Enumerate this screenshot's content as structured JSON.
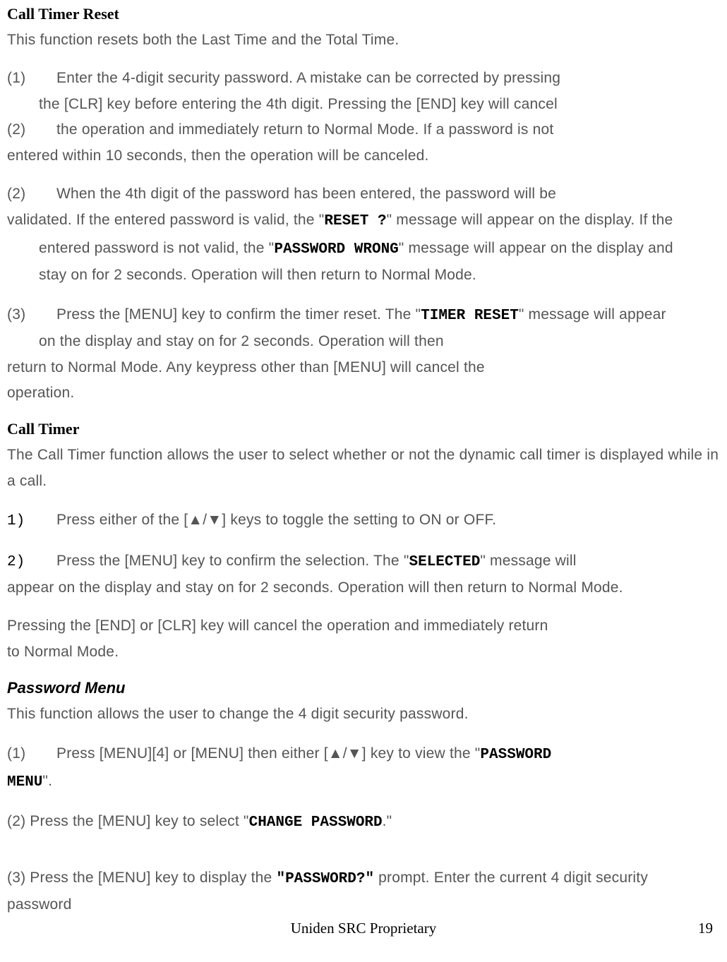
{
  "h1": "Call Timer Reset",
  "p1": "This function resets both the Last Time and the Total Time.",
  "s1n": "(1)",
  "s1a": "Enter the 4-digit security password.  A mistake can be corrected by pressing",
  "s1b": "the [CLR] key before entering the 4th digit. Pressing the [END] key will cancel",
  "s2n": "(2)",
  "s1c": "the operation and immediately return to Normal Mode. If a password is not",
  "s1d": "entered within 10 seconds, then the operation will be canceled.",
  "s2a_n": "(2)",
  "s2a": "When the 4th digit of the password has been entered, the password will be",
  "s2b_pre": "validated.  If  the  entered  password  is  valid,  the  \"",
  "s2b_reset": "RESET ?",
  "s2b_post": "\"  message  will  appear  on  the  display.  If  the",
  "s2c_pre": "entered  password  is  not  valid,  the  \"",
  "s2c_pw": "PASSWORD WRONG",
  "s2c_post": "\"  message  will  appear  on  the  display  and",
  "s2d": "stay on for 2 seconds.  Operation will then return to Normal Mode.",
  "s3n": "(3)",
  "s3a_pre": "Press  the  [MENU]  key  to  confirm  the  timer  reset.   The \"",
  "s3a_tr": "TIMER RESET",
  "s3a_post": "\"  message  will  appear",
  "s3b": "on the display and stay on for 2 seconds. Operation will then",
  "s3c": "return to Normal Mode. Any keypress other than [MENU] will cancel the",
  "s3d": "operation.",
  "h2": "Call Timer",
  "p2a": "The Call Timer function allows the user to select whether or not the dynamic call timer is displayed while in",
  "p2b": "a call.",
  "ct1n": "1)",
  "ct1a": "Press either of  the ",
  "arrows": "[▲/▼]",
  "ct1b": " keys to toggle the setting to ON or OFF.",
  "ct2n": "2)",
  "ct2a": "Press the [MENU] key to confirm the selection. The \"",
  "ct2_sel": "SELECTED",
  "ct2b": "\" message will",
  "ct2c": "appear on the display and stay on for 2 seconds. Operation will then return to Normal Mode.",
  "ct3a": "Pressing the [END] or [CLR] key will cancel the operation and immediately return",
  "ct3b": "to Normal Mode.",
  "h3": "Password Menu",
  "p3": "This function allows the user to change the 4 digit security password.",
  "pm1n": "(1)",
  "pm1a": "Press [MENU][4] or [MENU] then  either ",
  "pm1b": " key to view  the \"",
  "pm1_pw": "PASSWORD",
  "pm1_menu": "MENU",
  "pm1c": "\".",
  "pm2a": "(2)  Press the [MENU] key to select \"",
  "pm2_cp": "CHANGE PASSWORD",
  "pm2b": ".\"",
  "pm3a": "(3)  Press  the  [MENU]  key  to  display  the  ",
  "pm3_pw": "\"PASSWORD?\"",
  "pm3b": "  prompt.  Enter  the  current  4  digit  security",
  "pm3c": "password",
  "footer_c": "Uniden SRC Proprietary",
  "footer_r": "19"
}
